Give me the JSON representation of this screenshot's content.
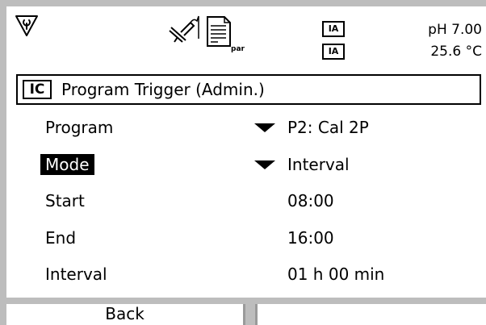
{
  "status": {
    "ph_value": "pH 7.00",
    "temp_value": "25.6 °C",
    "ia_top": "IA",
    "ia_bottom": "IA",
    "icons": {
      "left": "wrench-triangle-icon",
      "center": "sensor-probe-icon",
      "doc": "parameter-document-icon",
      "doc_label": "par"
    }
  },
  "title": {
    "badge": "IC",
    "text": "Program Trigger (Admin.)"
  },
  "rows": [
    {
      "label": "Program",
      "value": "P2: Cal 2P",
      "dropdown": true,
      "selected": false
    },
    {
      "label": "Mode",
      "value": "Interval",
      "dropdown": true,
      "selected": true
    },
    {
      "label": "Start",
      "value": "08:00",
      "dropdown": false,
      "selected": false
    },
    {
      "label": "End",
      "value": "16:00",
      "dropdown": false,
      "selected": false
    },
    {
      "label": "Interval",
      "value": "01 h 00 min",
      "dropdown": false,
      "selected": false
    }
  ],
  "softkeys": {
    "left": "Back",
    "right": ""
  }
}
